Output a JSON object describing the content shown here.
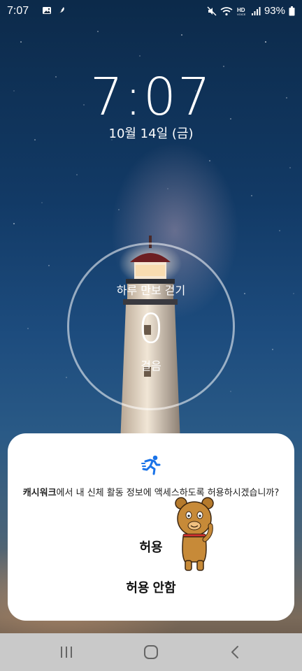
{
  "status_bar": {
    "time": "7:07",
    "battery": "93%",
    "left_icons": [
      "gallery-icon",
      "feather-icon"
    ],
    "right_icons": [
      "mute-icon",
      "wifi-icon",
      "hd-voice-icon",
      "signal-icon",
      "battery-icon"
    ]
  },
  "lock_screen": {
    "time": "7:07",
    "date": "10월 14일 (금)"
  },
  "step_widget": {
    "title": "하루 만보 걷기",
    "count": "0",
    "unit": "걸음"
  },
  "permission_dialog": {
    "app_name": "캐시워크",
    "message_rest": "에서 내 신체 활동 정보에 액세스하도록 허용하시겠습니까?",
    "allow_label": "허용",
    "deny_label": "허용 안함",
    "icon": "running-person-icon",
    "accent_color": "#1a73e8"
  },
  "nav_bar": {
    "buttons": [
      "recents-button",
      "home-button",
      "back-button"
    ]
  }
}
